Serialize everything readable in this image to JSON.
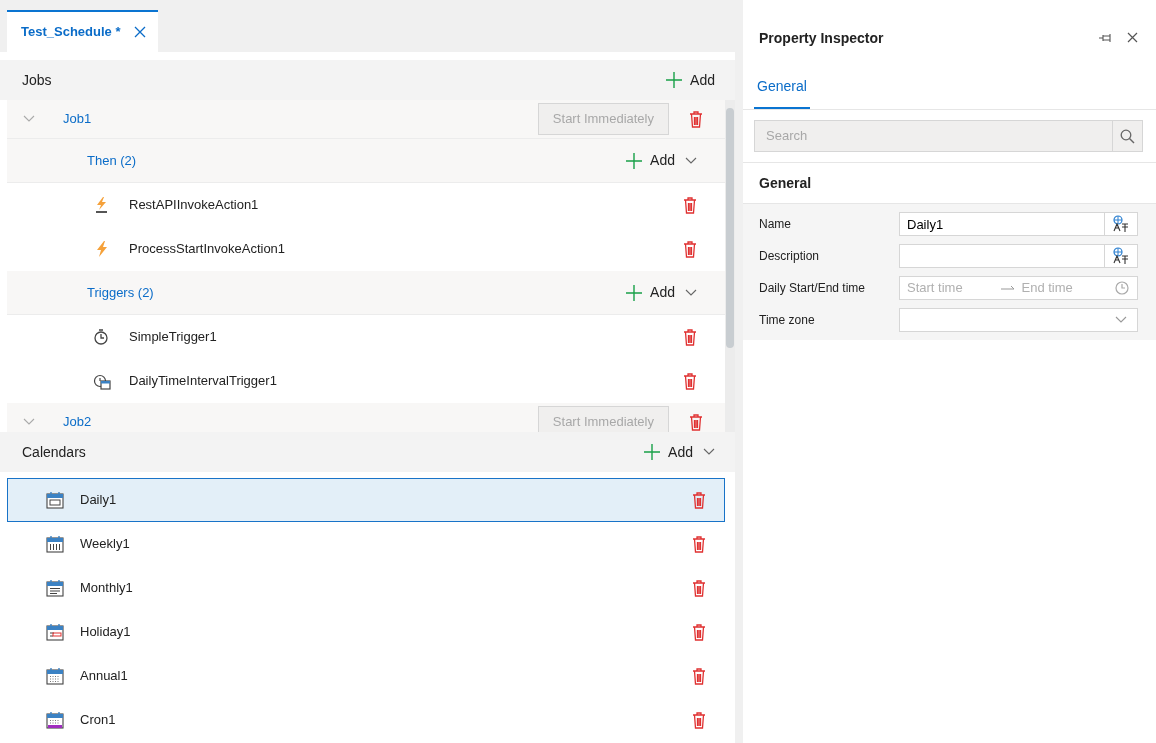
{
  "document_tabs": [
    {
      "label": "Test_Schedule *",
      "selected": true
    }
  ],
  "jobs": {
    "title": "Jobs",
    "add_label": "Add",
    "items": [
      {
        "name": "Job1",
        "start_button": "Start Immediately",
        "disabled": true,
        "groups": [
          {
            "label": "Then (2)",
            "add_label": "Add",
            "items": [
              {
                "name": "RestAPIInvokeAction1",
                "kind": "rest"
              },
              {
                "name": "ProcessStartInvokeAction1",
                "kind": "process"
              }
            ]
          },
          {
            "label": "Triggers (2)",
            "add_label": "Add",
            "items": [
              {
                "name": "SimpleTrigger1",
                "kind": "simple"
              },
              {
                "name": "DailyTimeIntervalTrigger1",
                "kind": "interval"
              }
            ]
          }
        ]
      },
      {
        "name": "Job2",
        "start_button": "Start Immediately",
        "disabled": true
      }
    ]
  },
  "calendars": {
    "title": "Calendars",
    "add_label": "Add",
    "items": [
      {
        "name": "Daily1",
        "kind": "daily",
        "selected": true
      },
      {
        "name": "Weekly1",
        "kind": "weekly",
        "selected": false
      },
      {
        "name": "Monthly1",
        "kind": "monthly",
        "selected": false
      },
      {
        "name": "Holiday1",
        "kind": "holiday",
        "selected": false
      },
      {
        "name": "Annual1",
        "kind": "annual",
        "selected": false
      },
      {
        "name": "Cron1",
        "kind": "cron",
        "selected": false
      }
    ]
  },
  "inspector": {
    "title": "Property Inspector",
    "tabs": [
      {
        "label": "General",
        "selected": true
      }
    ],
    "search": {
      "placeholder": "Search"
    },
    "section": "General",
    "properties": [
      {
        "label": "Name",
        "kind": "text",
        "value": "Daily1"
      },
      {
        "label": "Description",
        "kind": "text"
      },
      {
        "label": "Daily Start/End time",
        "kind": "time-range",
        "start_placeholder": "Start time",
        "end_placeholder": "End time"
      },
      {
        "label": "Time zone",
        "kind": "select"
      }
    ]
  }
}
